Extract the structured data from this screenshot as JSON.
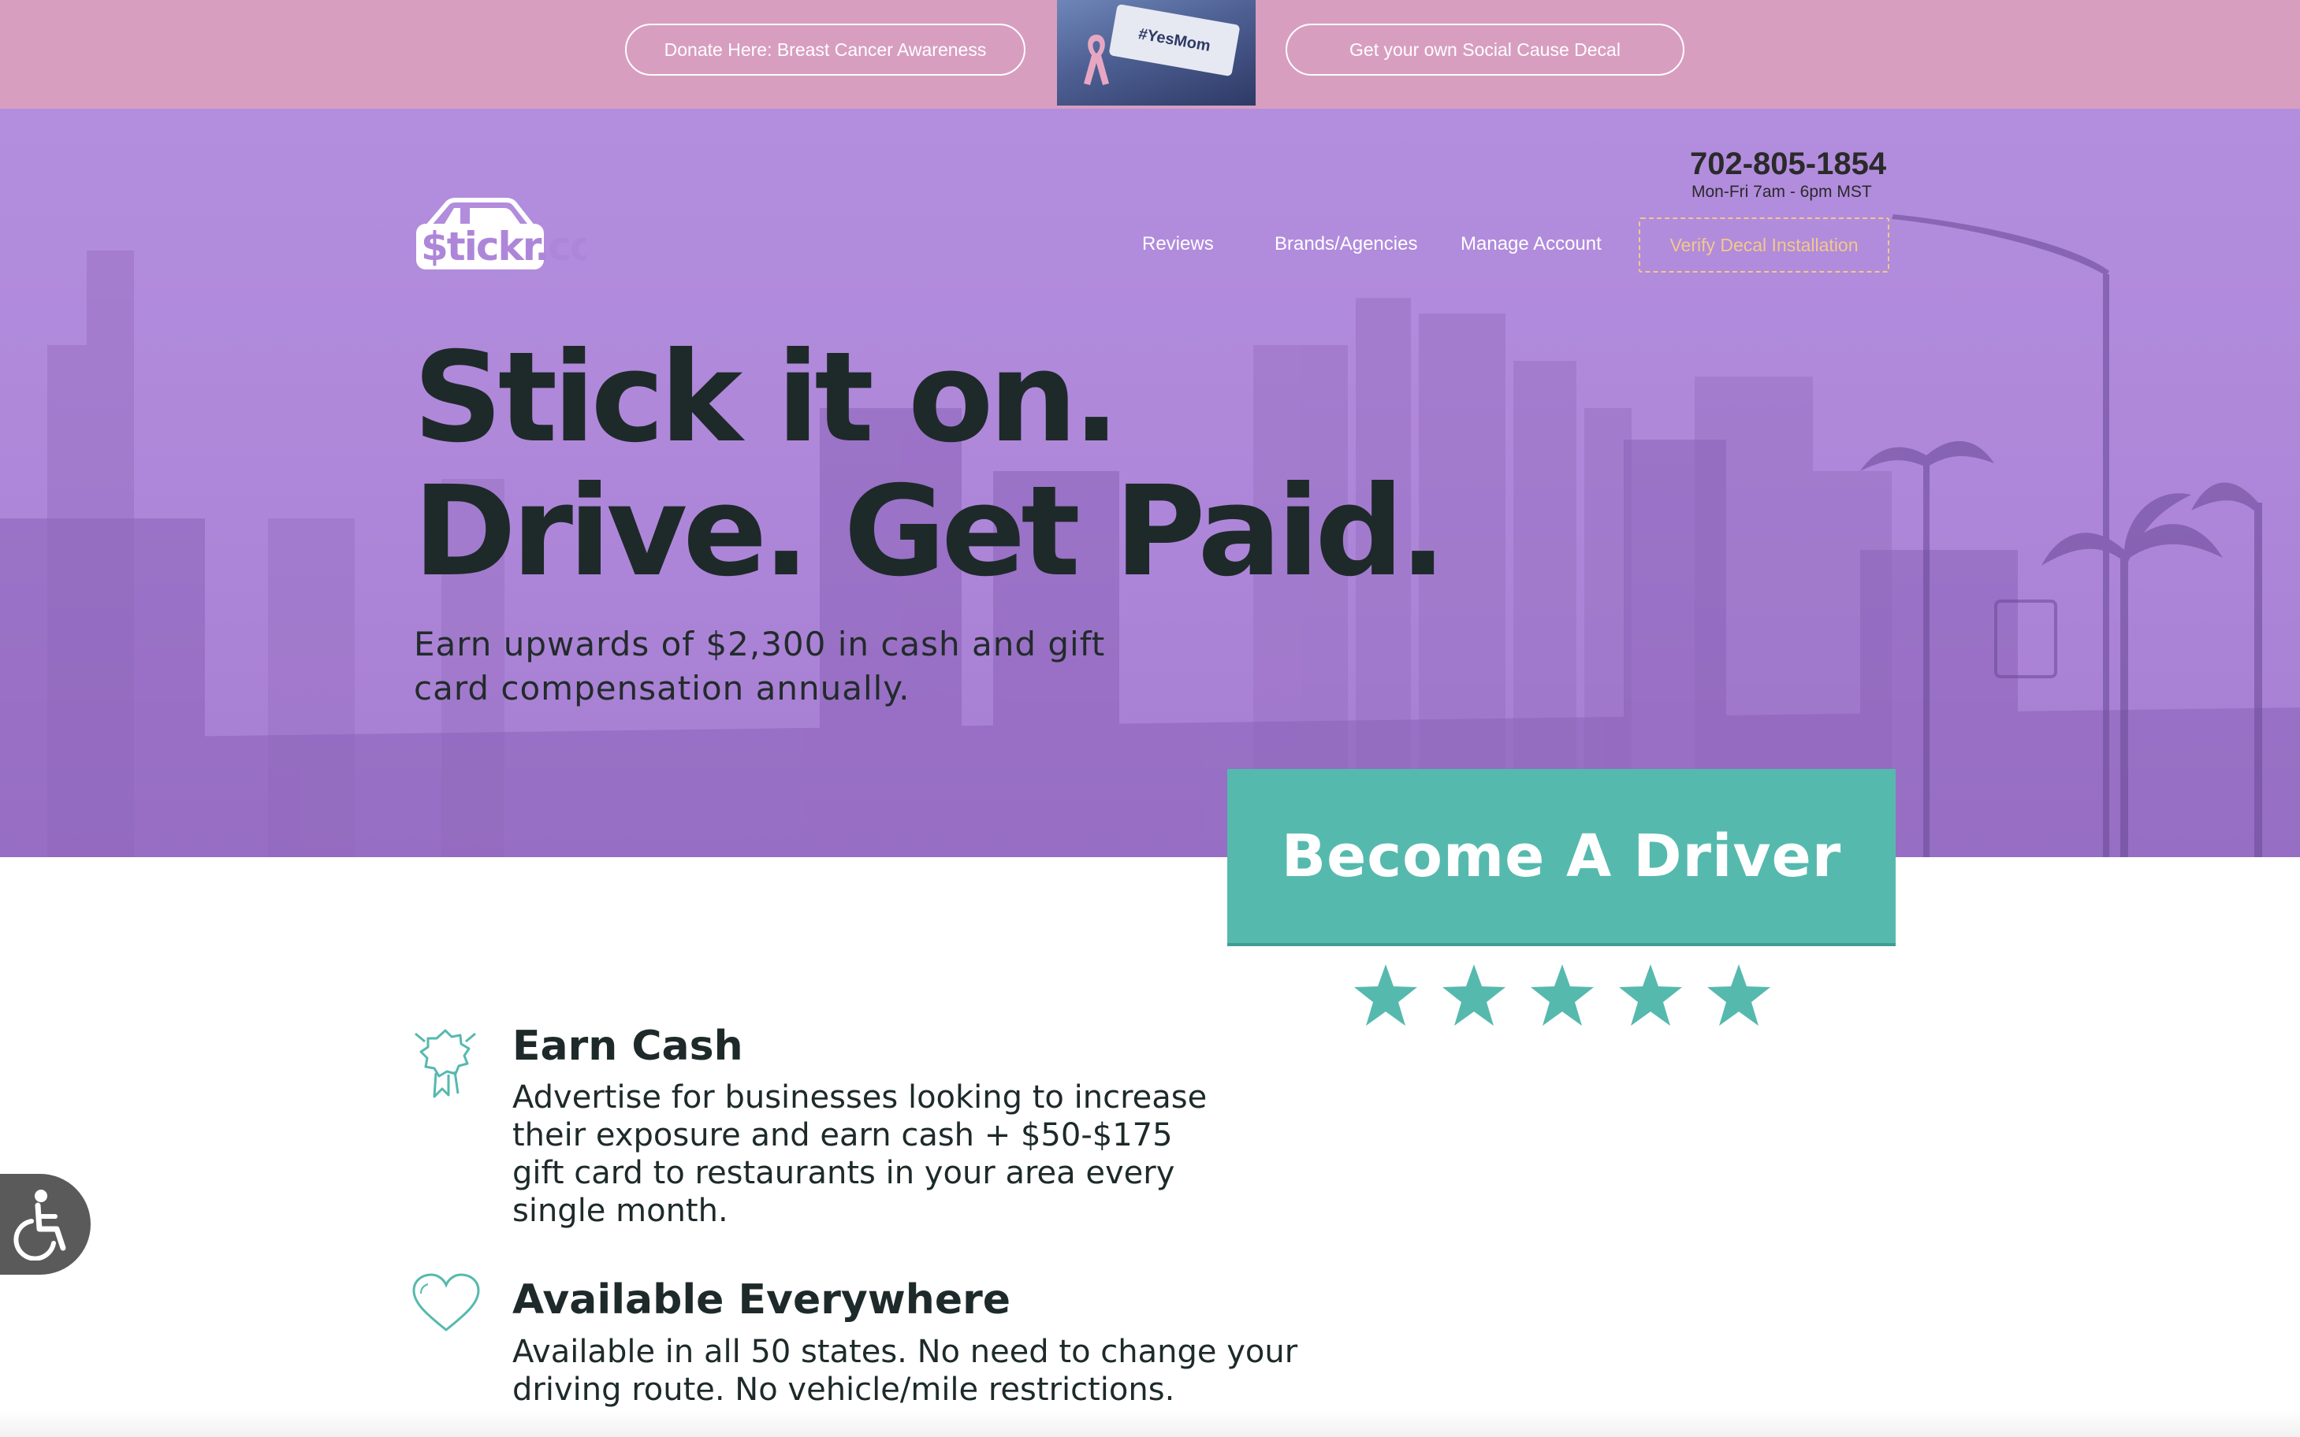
{
  "top_banner": {
    "donate_label": "Donate Here: Breast Cancer Awareness",
    "decal_label": "Get your own Social Cause Decal",
    "thumbnail_text": "#YesMom"
  },
  "header": {
    "logo_text": "$tickr.co",
    "phone": "702-805-1854",
    "hours": "Mon-Fri 7am - 6pm MST",
    "nav": {
      "reviews": "Reviews",
      "brands": "Brands/Agencies",
      "manage": "Manage Account",
      "verify": "Verify Decal Installation"
    }
  },
  "hero": {
    "headline_line1": "Stick it on.",
    "headline_line2": "Drive. Get Paid.",
    "subtext": "Earn upwards of $2,300 in cash and gift card compensation annually."
  },
  "cta": {
    "label": "Become A Driver",
    "rating_stars": 5
  },
  "features": [
    {
      "icon": "award-ribbon-icon",
      "title": "Earn Cash",
      "description": "Advertise for businesses looking to increase their exposure and earn cash + $50-$175 gift card to restaurants in your area every single month."
    },
    {
      "icon": "heart-icon",
      "title": "Available Everywhere",
      "description": "Available in all 50 states. No need to change your driving route. No vehicle/mile restrictions."
    }
  ],
  "colors": {
    "banner_pink": "#d89ec0",
    "hero_purple": "#b08ae0",
    "accent_teal": "#56b9ae",
    "dark_text": "#1e2a2a",
    "verify_gold": "#f2c88b"
  }
}
